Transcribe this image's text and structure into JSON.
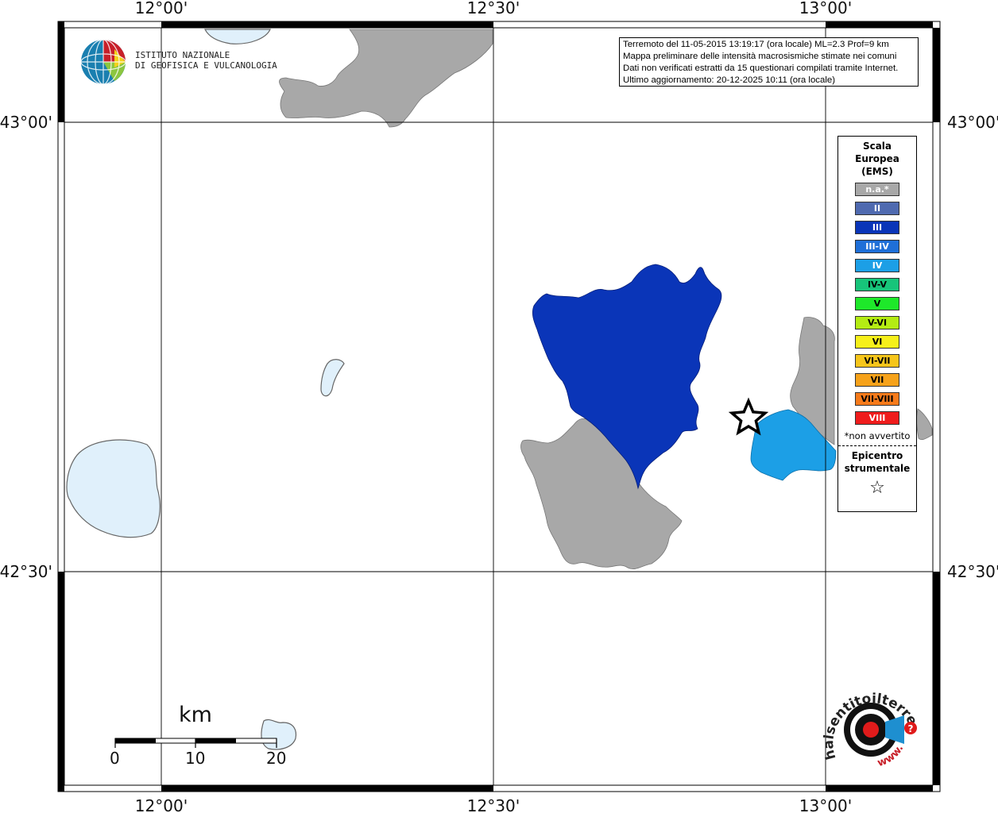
{
  "lon_labels": [
    "12°00'",
    "12°30'",
    "13°00'"
  ],
  "lat_labels": [
    "43°00'",
    "42°30'"
  ],
  "info": {
    "line1": "Terremoto del 11-05-2015 13:19:17 (ora locale) ML=2.3 Prof=9 km",
    "line2": "Mappa preliminare delle intensità macrosismiche stimate nei comuni",
    "line3": "Dati non verificati estratti da 15 questionari compilati tramite Internet.",
    "line4": "Ultimo aggiornamento: 20-12-2025 10:11 (ora locale)"
  },
  "institute": {
    "line1": "ISTITUTO NAZIONALE",
    "line2": "DI GEOFISICA E VULCANOLOGIA"
  },
  "legend": {
    "title1": "Scala",
    "title2": "Europea",
    "title3": "(EMS)",
    "items": [
      {
        "label": "n.a.*",
        "color": "#a8a8a8",
        "text": "#ffffff"
      },
      {
        "label": "II",
        "color": "#4f6ab0",
        "text": "#ffffff"
      },
      {
        "label": "III",
        "color": "#0a35b8",
        "text": "#ffffff"
      },
      {
        "label": "III-IV",
        "color": "#1f6fd8",
        "text": "#ffffff"
      },
      {
        "label": "IV",
        "color": "#1c9fe6",
        "text": "#ffffff"
      },
      {
        "label": "IV-V",
        "color": "#17c47a",
        "text": "#000000"
      },
      {
        "label": "V",
        "color": "#1ee82a",
        "text": "#000000"
      },
      {
        "label": "V-VI",
        "color": "#b4ec13",
        "text": "#000000"
      },
      {
        "label": "VI",
        "color": "#f6f01a",
        "text": "#000000"
      },
      {
        "label": "VI-VII",
        "color": "#f6c51a",
        "text": "#000000"
      },
      {
        "label": "VII",
        "color": "#f6a21a",
        "text": "#000000"
      },
      {
        "label": "VII-VIII",
        "color": "#f67a1a",
        "text": "#000000"
      },
      {
        "label": "VIII",
        "color": "#ef1c1c",
        "text": "#ffffff"
      }
    ],
    "note": "*non avvertito",
    "epi1": "Epicentro",
    "epi2": "strumentale",
    "epi_symbol": "☆"
  },
  "scale_bar": {
    "unit": "km",
    "ticks": [
      "0",
      "10",
      "20"
    ]
  },
  "hsit_logo": {
    "top": "haisentitoilterremoto.it",
    "bottom": "www."
  },
  "colors": {
    "intensity_III": "#0a35b8",
    "intensity_IV": "#1c9fe6",
    "not_felt": "#a8a8a8",
    "lake": "#e0f0fb"
  }
}
